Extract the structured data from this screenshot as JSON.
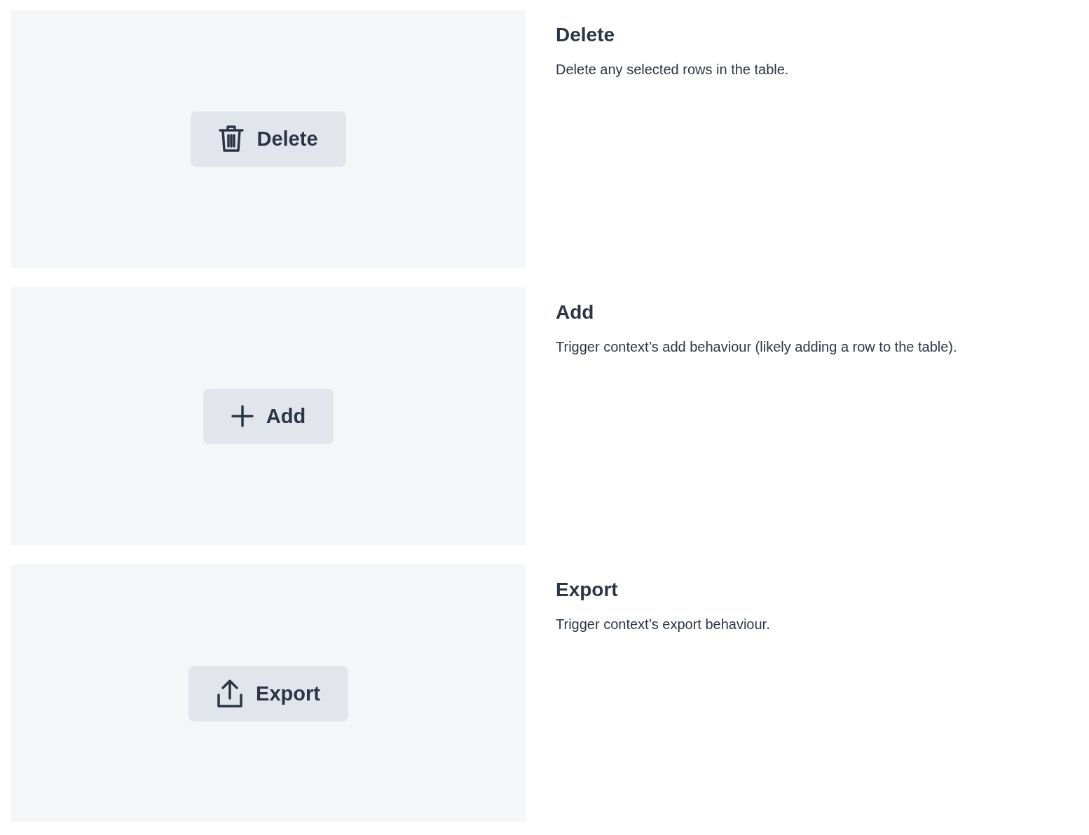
{
  "actions": [
    {
      "kind": "delete",
      "button": "Delete",
      "title": "Delete",
      "description": "Delete any selected rows in the table."
    },
    {
      "kind": "add",
      "button": "Add",
      "title": "Add",
      "description": "Trigger context’s add behaviour (likely adding a row to the table)."
    },
    {
      "kind": "export",
      "button": "Export",
      "title": "Export",
      "description": "Trigger context’s export behaviour."
    }
  ]
}
